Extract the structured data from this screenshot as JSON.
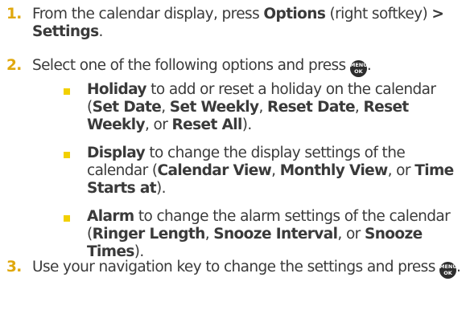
{
  "steps": [
    {
      "number": "1.",
      "text_a": "From the calendar display, press ",
      "bold_a": "Options",
      "text_b": " (right softkey) ",
      "chevron": ">",
      "bold_b": "Settings",
      "end": "."
    },
    {
      "number": "2.",
      "text_a": "Select one of the following options and press ",
      "end": "."
    },
    {
      "number": "3.",
      "text_a": "Use your navigation key to change the settings and press ",
      "end": "."
    }
  ],
  "menu_key_label": [
    "MENU",
    "OK"
  ],
  "bullets": [
    {
      "term": "Holiday",
      "desc": " to add or reset a holiday on the calendar (",
      "opts": [
        "Set Date",
        "Set Weekly",
        "Reset Date",
        "Reset Weekly",
        "Reset All"
      ],
      "sep": ", ",
      "or": ", or ",
      "close": ")."
    },
    {
      "term": "Display",
      "desc": " to change the display settings of the calendar (",
      "opts": [
        "Calendar View",
        "Monthly View",
        "Time Starts at"
      ],
      "sep": ", ",
      "or": ", or ",
      "close": ")."
    },
    {
      "term": "Alarm",
      "desc": " to change the alarm settings of the calendar (",
      "opts": [
        "Ringer Length",
        "Snooze Interval",
        "Snooze Times"
      ],
      "sep": ", ",
      "or": ", or ",
      "close": ")."
    }
  ],
  "colors": {
    "number": "#e0a80d",
    "bullet": "#f2d000",
    "text": "#3a3a3a"
  },
  "icons": {
    "menu_key": "menu-ok-key-icon",
    "bullet": "square-bullet-icon"
  }
}
